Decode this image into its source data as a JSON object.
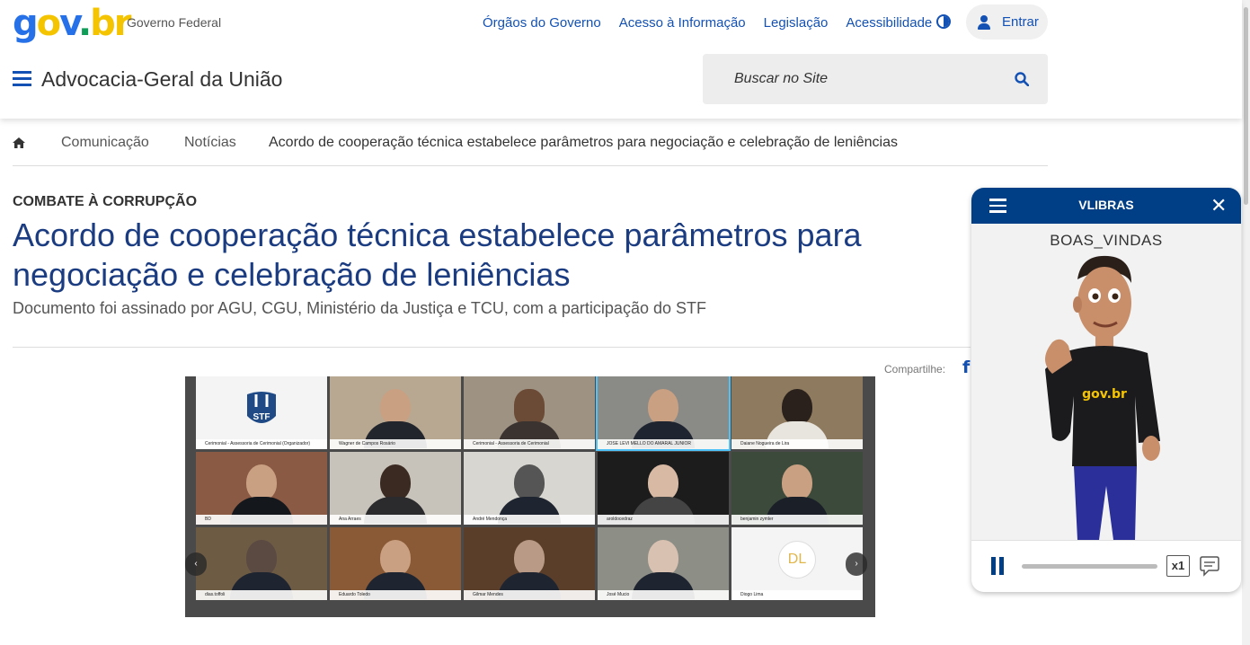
{
  "header": {
    "logo_text": {
      "g": "g",
      "o": "o",
      "v": "v",
      "dot": ".",
      "br": "br"
    },
    "gov_label": "Governo Federal",
    "nav": [
      "Órgãos do Governo",
      "Acesso à Informação",
      "Legislação",
      "Acessibilidade"
    ],
    "login_label": "Entrar",
    "site_title": "Advocacia-Geral da União",
    "search_placeholder": "Buscar no Site"
  },
  "breadcrumb": {
    "items": [
      "Comunicação",
      "Notícias",
      "Acordo de cooperação técnica estabelece parâmetros para negociação e celebração de leniências"
    ]
  },
  "article": {
    "kicker": "COMBATE À CORRUPÇÃO",
    "title": "Acordo de cooperação técnica estabelece parâmetros para negociação e celebração de leniências",
    "subtitle": "Documento foi assinado por AGU, CGU, Ministério da Justiça e TCU, com a participação do STF",
    "share_label": "Compartilhe:",
    "photo": {
      "tiles": [
        "Cerimonial - Assessoria de Cerimonial (Organizador)",
        "Wagner de Campos Rosário",
        "Cerimonial - Assessoria de Cerimonial",
        "JOSE LEVI MELLO DO AMARAL JUNIOR",
        "Daiane Nogueira de Lira",
        "BD",
        "Ana Arraes",
        "André Mendonça",
        "aroldocedraz",
        "benjamin zymler",
        "dias.toffoli",
        "Eduardo Toledo",
        "Gilmar Mendes",
        "José Mucio",
        "Diogo Lima"
      ],
      "stf_label": "STF",
      "dl_initials": "DL"
    }
  },
  "vlibras": {
    "title": "VLIBRAS",
    "word": "BOAS_VINDAS",
    "shirt_logo": "gov.br",
    "speed": "x1",
    "progress": 0
  }
}
